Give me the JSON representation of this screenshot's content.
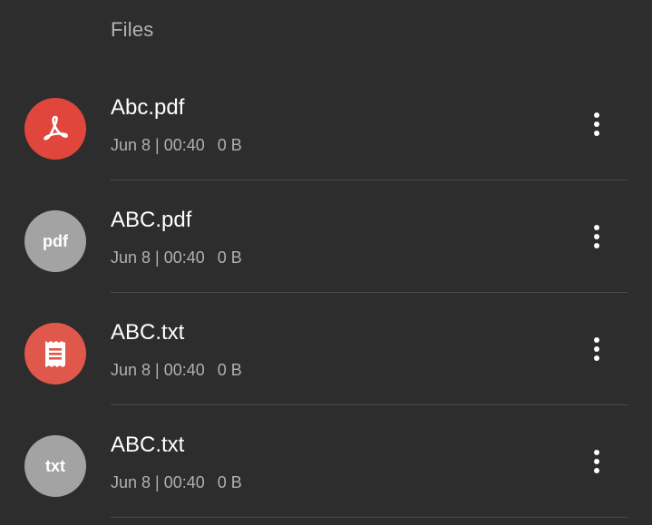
{
  "section": {
    "title": "Files"
  },
  "files": [
    {
      "name": "Abc.pdf",
      "date": "Jun 8 | 00:40",
      "size": "0 B",
      "icon": "acrobat-pdf-icon",
      "icon_color": "#e0463c"
    },
    {
      "name": "ABC.pdf",
      "date": "Jun 8 | 00:40",
      "size": "0 B",
      "icon": "pdf-text-icon",
      "icon_label": "pdf",
      "icon_color": "#a3a3a3"
    },
    {
      "name": "ABC.txt",
      "date": "Jun 8 | 00:40",
      "size": "0 B",
      "icon": "text-document-icon",
      "icon_color": "#e0574b"
    },
    {
      "name": "ABC.txt",
      "date": "Jun 8 | 00:40",
      "size": "0 B",
      "icon": "txt-text-icon",
      "icon_label": "txt",
      "icon_color": "#a3a3a3"
    }
  ]
}
